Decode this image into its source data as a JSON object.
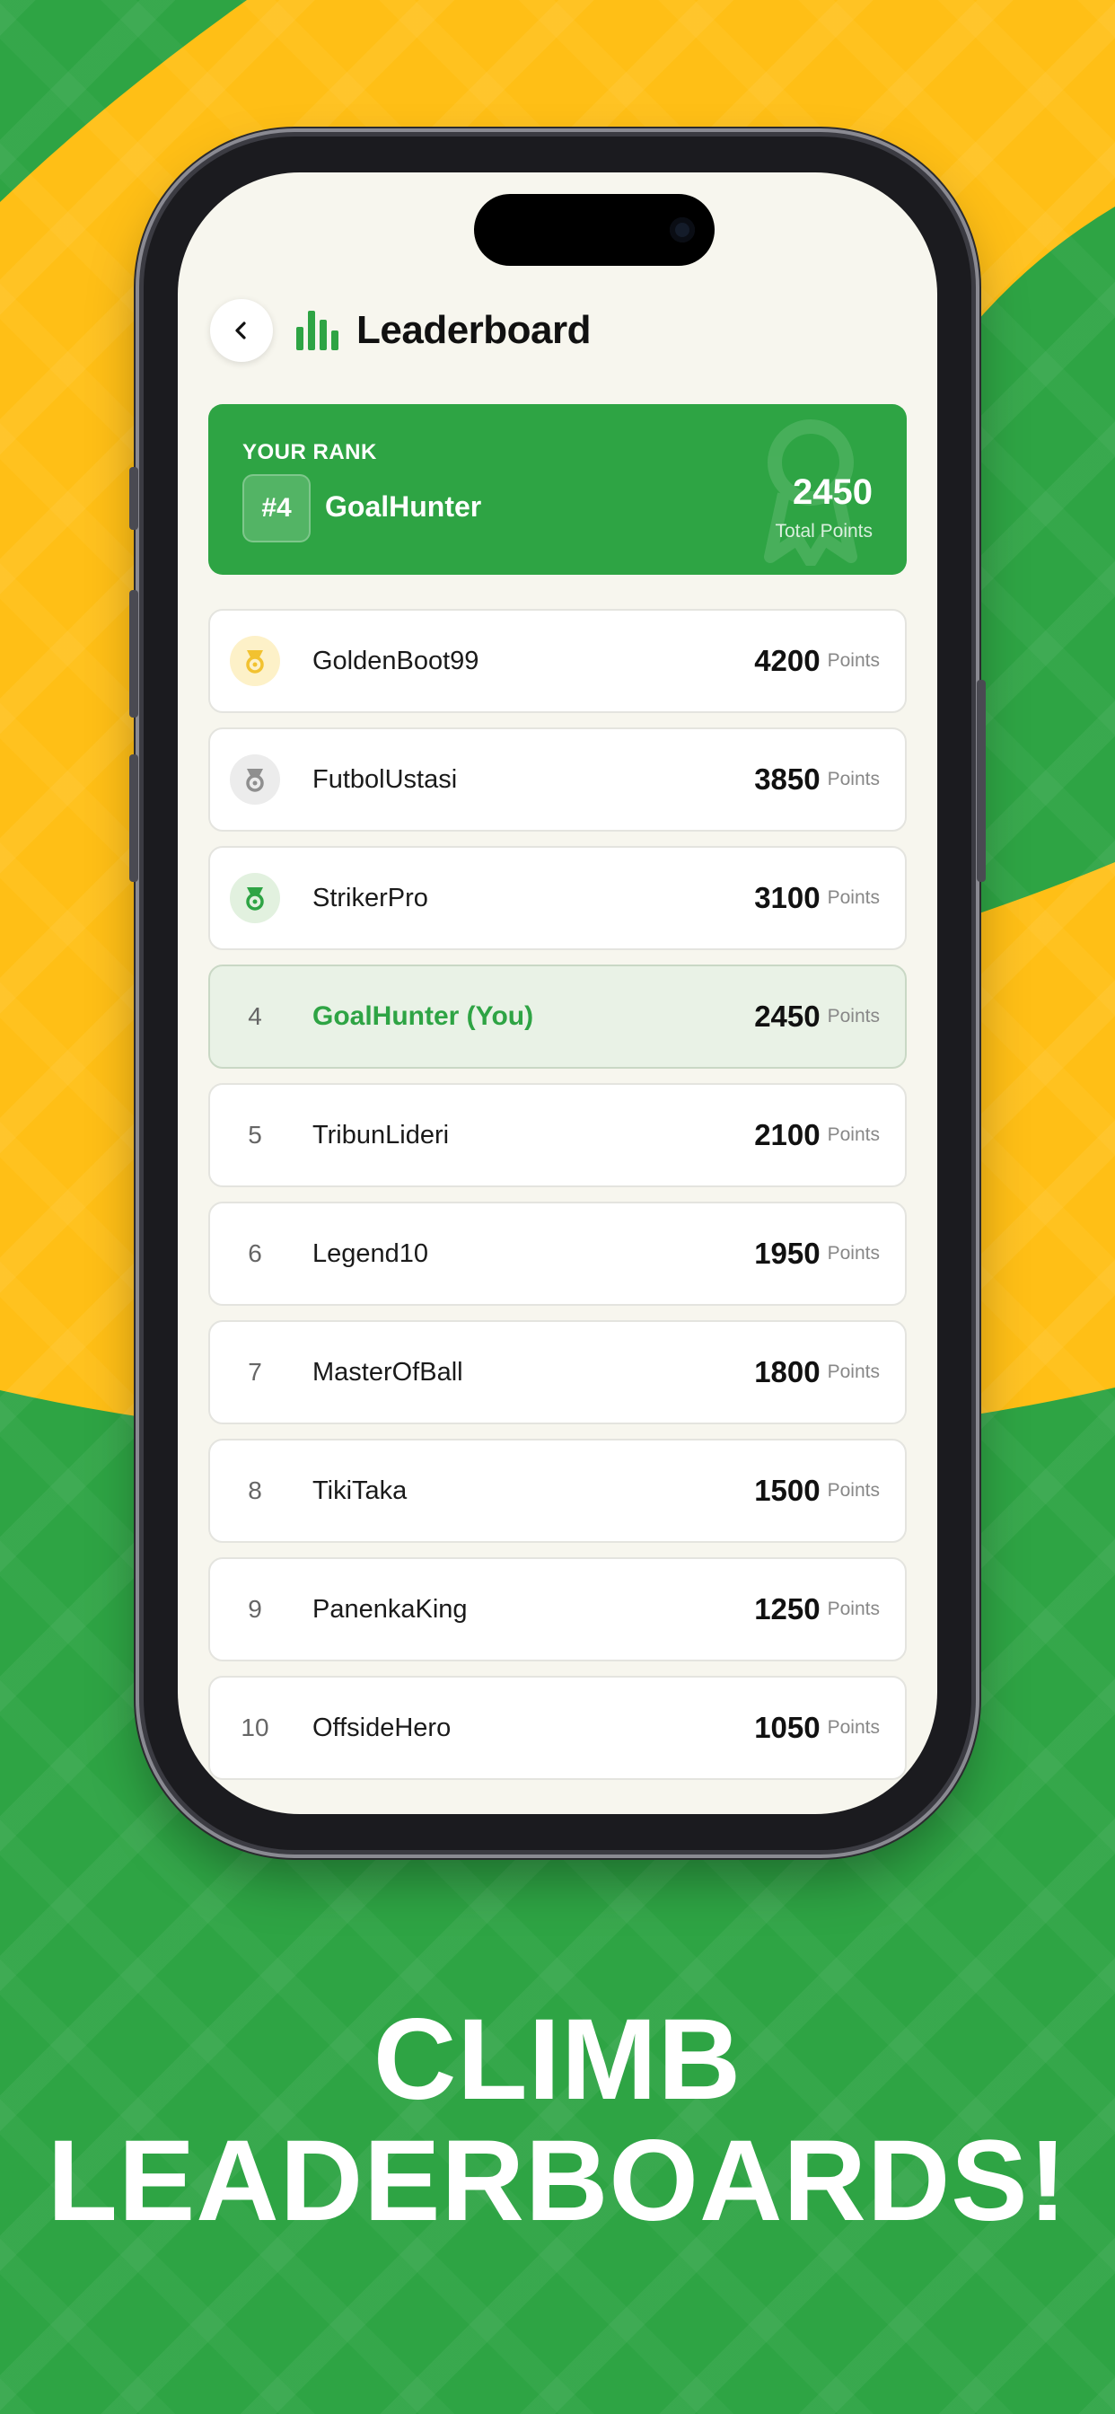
{
  "header": {
    "title": "Leaderboard"
  },
  "your_rank": {
    "label": "YOUR RANK",
    "rank": "#4",
    "username": "GoalHunter",
    "points": "2450",
    "points_label": "Total Points"
  },
  "leaderboard": [
    {
      "position": "1",
      "username": "GoldenBoot99",
      "points": "4200",
      "unit": "Points",
      "medal": "gold-medal-icon"
    },
    {
      "position": "2",
      "username": "FutbolUstasi",
      "points": "3850",
      "unit": "Points",
      "medal": "silver-medal-icon"
    },
    {
      "position": "3",
      "username": "StrikerPro",
      "points": "3100",
      "unit": "Points",
      "medal": "bronze-medal-icon"
    },
    {
      "position": "4",
      "username": "GoalHunter (You)",
      "points": "2450",
      "unit": "Points"
    },
    {
      "position": "5",
      "username": "TribunLideri",
      "points": "2100",
      "unit": "Points"
    },
    {
      "position": "6",
      "username": "Legend10",
      "points": "1950",
      "unit": "Points"
    },
    {
      "position": "7",
      "username": "MasterOfBall",
      "points": "1800",
      "unit": "Points"
    },
    {
      "position": "8",
      "username": "TikiTaka",
      "points": "1500",
      "unit": "Points"
    },
    {
      "position": "9",
      "username": "PanenkaKing",
      "points": "1250",
      "unit": "Points"
    },
    {
      "position": "10",
      "username": "OffsideHero",
      "points": "1050",
      "unit": "Points"
    }
  ],
  "promo": {
    "line1": "CLIMB",
    "line2": "LEADERBOARDS!"
  },
  "colors": {
    "brand_green": "#2ea444",
    "brand_yellow": "#ffbf16",
    "gold": "#f2c230",
    "silver": "#8f8f8f",
    "bronze": "#2ea444"
  }
}
